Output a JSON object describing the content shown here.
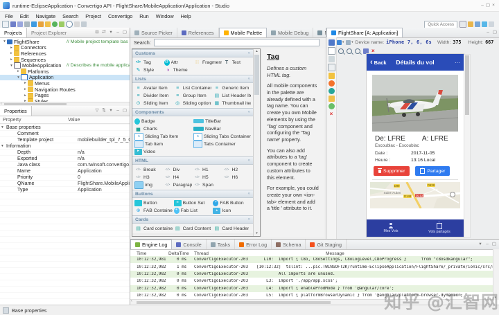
{
  "window": {
    "title": "runtime-EclipseApplication - Convertigo API - FlightShare/MobileApplication/Application - Studio",
    "menus": [
      "File",
      "Edit",
      "Navigate",
      "Search",
      "Project",
      "Convertigo",
      "Run",
      "Window",
      "Help"
    ],
    "toolbar_icons": [
      "new-icon",
      "save-icon",
      "save-all-icon",
      "print-icon",
      "engine-icon",
      "test-platform-icon",
      "pencil-icon",
      "run-icon",
      "debug-icon",
      "search-icon",
      "stop-icon",
      "link-icon"
    ],
    "quick_access": "Quick Access",
    "perspective_icons": [
      "editor-area-icon",
      "java-perspective-icon",
      "debug-perspective-icon",
      "convertigo-perspective-icon",
      "resource-perspective-icon"
    ],
    "window_controls": [
      "minimize-icon",
      "maximize-icon",
      "close-icon"
    ],
    "status_bar": "Base properties"
  },
  "projects_panel": {
    "tabs": [
      {
        "label": "Projects",
        "active": true
      },
      {
        "label": "Project Explorer"
      }
    ],
    "toolbar_icons": [
      "collapse-all-icon",
      "link-editor-icon",
      "view-menu-icon",
      "minimize-icon",
      "maximize-icon"
    ],
    "tree": [
      {
        "label": "FlightShare",
        "icon": "project-icon",
        "depth": 0,
        "arrow": "▾",
        "comment": "// Mobile project template bas"
      },
      {
        "label": "Connectors",
        "icon": "folder-icon",
        "depth": 1,
        "arrow": "▸"
      },
      {
        "label": "References",
        "icon": "folder-icon",
        "depth": 1,
        "arrow": "▸"
      },
      {
        "label": "Sequences",
        "icon": "folder-icon",
        "depth": 1,
        "arrow": "▸"
      },
      {
        "label": "MobileApplication",
        "icon": "mobile-app-icon",
        "depth": 1,
        "arrow": "▾",
        "comment": "// Describes the mobile applica"
      },
      {
        "label": "Platforms",
        "icon": "folder-icon",
        "depth": 2,
        "arrow": "▸"
      },
      {
        "label": "Application",
        "icon": "application-icon",
        "depth": 2,
        "arrow": "▾",
        "selected": true
      },
      {
        "label": "Menus",
        "icon": "folder-icon",
        "depth": 3,
        "arrow": "▸"
      },
      {
        "label": "Navigation Routes",
        "icon": "folder-icon",
        "depth": 3,
        "arrow": "▸"
      },
      {
        "label": "Pages",
        "icon": "folder-icon",
        "depth": 3,
        "arrow": "▸"
      },
      {
        "label": "Styles",
        "icon": "folder-icon",
        "depth": 3,
        "arrow": "▸"
      }
    ]
  },
  "properties_panel": {
    "tab": "Properties",
    "toolbar_icons": [
      "filter-icon",
      "sort-icon",
      "view-menu-icon",
      "minimize-icon",
      "maximize-icon"
    ],
    "columns": [
      "Property",
      "Value"
    ],
    "rows": [
      {
        "label": "Base properties",
        "value": "",
        "group": true,
        "selected": true,
        "arrow": "▾"
      },
      {
        "label": "Comment",
        "value": ""
      },
      {
        "label": "Template project",
        "value": "mobilebuilder_tpl_7_5_0"
      },
      {
        "label": "Information",
        "value": "",
        "group": true,
        "arrow": "▾"
      },
      {
        "label": "Depth",
        "value": "n/a"
      },
      {
        "label": "Exported",
        "value": "n/a"
      },
      {
        "label": "Java class",
        "value": "com.twinsoft.convertigo.beans..."
      },
      {
        "label": "Name",
        "value": "Application"
      },
      {
        "label": "Priority",
        "value": "0"
      },
      {
        "label": "QName",
        "value": "FlightShare.MobileApplication..."
      },
      {
        "label": "Type",
        "value": "Application"
      }
    ]
  },
  "palette_panel": {
    "tabs": [
      {
        "label": "Source Picker",
        "icon": "source-picker-icon"
      },
      {
        "label": "References",
        "icon": "references-icon"
      },
      {
        "label": "Mobile Palette",
        "icon": "mobile-palette-icon",
        "active": true
      },
      {
        "label": "Mobile Debug",
        "icon": "mobile-debug-icon"
      },
      {
        "label": "Mobile Picker",
        "icon": "mobile-picker-icon"
      }
    ],
    "search_label": "Search:",
    "search_value": "",
    "sections": [
      {
        "label": "Customs",
        "cols": 4,
        "items": [
          {
            "label": "Tag",
            "icon": "tag-icon"
          },
          {
            "label": "Attr",
            "icon": "attr-icon"
          },
          {
            "label": "Fragment",
            "icon": "fragment-icon"
          },
          {
            "label": "Text",
            "icon": "text-icon"
          },
          {
            "label": "Style",
            "icon": "style-icon"
          },
          {
            "label": "Theme",
            "icon": "theme-icon"
          }
        ]
      },
      {
        "label": "Lists",
        "cols": 3,
        "items": [
          {
            "label": "Avatar Item",
            "icon": "avatar-item-icon"
          },
          {
            "label": "List Container",
            "icon": "list-container-icon"
          },
          {
            "label": "Generic Item",
            "icon": "generic-item-icon"
          },
          {
            "label": "Divider Item",
            "icon": "divider-item-icon"
          },
          {
            "label": "Group Item",
            "icon": "group-item-icon"
          },
          {
            "label": "List Header Item",
            "icon": "list-header-item-icon"
          },
          {
            "label": "Sliding Item",
            "icon": "sliding-item-icon"
          },
          {
            "label": "Sliding options",
            "icon": "sliding-options-icon"
          },
          {
            "label": "Thumbnail item",
            "icon": "thumbnail-item-icon"
          }
        ]
      },
      {
        "label": "Components",
        "cols": 2,
        "items": [
          {
            "label": "Badge",
            "icon": "badge-icon"
          },
          {
            "label": "TitleBar",
            "icon": "titlebar-icon"
          },
          {
            "label": "Charts",
            "icon": "charts-icon"
          },
          {
            "label": "NavBar",
            "icon": "navbar-icon"
          },
          {
            "label": "Sliding Tab Item",
            "icon": "sliding-tab-item-icon"
          },
          {
            "label": "Sliding Tabs Container",
            "icon": "sliding-tabs-container-icon"
          },
          {
            "label": "Tab Item",
            "icon": "tab-item-icon"
          },
          {
            "label": "Tabs Container",
            "icon": "tabs-container-icon"
          },
          {
            "label": "Video",
            "icon": "video-icon"
          }
        ]
      },
      {
        "label": "HTML",
        "cols": 4,
        "items": [
          {
            "label": "Break",
            "icon": "code-icon"
          },
          {
            "label": "Div",
            "icon": "code-icon"
          },
          {
            "label": "H1",
            "icon": "code-icon"
          },
          {
            "label": "H2",
            "icon": "code-icon"
          },
          {
            "label": "H3",
            "icon": "code-icon"
          },
          {
            "label": "H4",
            "icon": "code-icon"
          },
          {
            "label": "H5",
            "icon": "code-icon"
          },
          {
            "label": "H6",
            "icon": "code-icon"
          },
          {
            "label": "img",
            "icon": "img-icon"
          },
          {
            "label": "Paragraph",
            "icon": "code-icon"
          },
          {
            "label": "Span",
            "icon": "code-icon"
          }
        ]
      },
      {
        "label": "Buttons",
        "cols": 3,
        "items": [
          {
            "label": "Button",
            "icon": "button-icon"
          },
          {
            "label": "Button Set",
            "icon": "button-set-icon"
          },
          {
            "label": "FAB Button",
            "icon": "fab-button-icon"
          },
          {
            "label": "FAB Container",
            "icon": "fab-container-icon"
          },
          {
            "label": "Fab List",
            "icon": "fab-list-icon"
          },
          {
            "label": "Icon",
            "icon": "icon-icon"
          }
        ]
      },
      {
        "label": "Cards",
        "cols": 3,
        "items": [
          {
            "label": "Card container",
            "icon": "card-container-icon"
          },
          {
            "label": "Card Content",
            "icon": "card-content-icon"
          },
          {
            "label": "Card Header",
            "icon": "card-header-icon"
          }
        ]
      }
    ],
    "description": {
      "title": "Tag",
      "subtitle": "Defines a custom HTML tag.",
      "paragraphs": [
        "All mobile components in the palette are already defined with a tag name. You can create you own Mobile elements by using the 'Tag' component and configuring the 'Tag name' property.",
        "You can also add attributes to a 'tag' component to create custom attributes to this element.",
        "For example, you could create your own <ion-tab> element and add a 'title ' attribute to it."
      ]
    }
  },
  "preview_panel": {
    "tab": {
      "label": "FlightShare [A: Application]",
      "icon": "flightshare-tab-icon",
      "active": true
    },
    "device_label": "Device name:",
    "device_name": "iPhone 7, 6, 6s",
    "width_label": "Width:",
    "width_value": "375",
    "height_label": "Height:",
    "height_value": "667",
    "zoom_icons": [
      "zoom-out-icon",
      "zoom-in-icon",
      "zoom-fit-icon",
      "save-icon",
      "close-icon"
    ],
    "side_icons": [
      "grid-icon",
      "page-icon",
      "copy-icon",
      "mail-icon",
      "folder-icon",
      "browser-icon",
      "package-icon",
      "pencil-icon",
      "undo-icon",
      "delete-icon"
    ],
    "phone": {
      "header_color": "#2a4cb8",
      "tabbar_color": "#2c3ea0",
      "delete_color": "#e8433a",
      "share_color": "#2f7bf0",
      "back_label": "Back",
      "title": "Détails du vol",
      "from_label": "De: LFRE",
      "to_label": "A: LFRE",
      "route": "Escoublac - Escoublac",
      "date_label": "Date :",
      "date_value": "2017-11-05",
      "time_label": "Heure :",
      "time_value": "13:16 Local",
      "delete_label": "Supprimer",
      "share_label": "Partager",
      "map": {
        "place": "Saint-Aubin",
        "badges": [
          {
            "text": "D99"
          },
          {
            "text": "D938"
          },
          {
            "text": "D148"
          },
          {
            "text": "D213",
            "red": true
          }
        ]
      },
      "tabs": [
        {
          "label": "Mes Vols",
          "icon": "person-icon"
        },
        {
          "label": "Vols partagés",
          "icon": "share-icon"
        }
      ]
    }
  },
  "log_panel": {
    "tabs": [
      {
        "label": "Engine Log",
        "icon": "engine-log-icon",
        "active": true
      },
      {
        "label": "Console",
        "icon": "console-icon"
      },
      {
        "label": "Tasks",
        "icon": "tasks-icon"
      },
      {
        "label": "Error Log",
        "icon": "error-log-icon"
      },
      {
        "label": "Schema",
        "icon": "schema-icon"
      },
      {
        "label": "Git Staging",
        "icon": "git-staging-icon"
      }
    ],
    "columns": [
      "Time",
      "DeltaTime",
      "Thread",
      "Message"
    ],
    "rows": [
      [
        "10:12:32,981",
        "0 ms",
        "ConvertigoExecutor-203",
        "   L10:  import { C8o, C8oSettings, C8oLogLevel,C8oProgress }      from \"c8osdkangular\";"
      ],
      [
        "10:12:32,982",
        "1 ms",
        "ConvertigoExecutor-203",
        "[10:12:32]  tslint: ...pic.TWINSOFT2K/runtime-EclipseApplication/FlightShare/_private/ionic/src/ma"
      ],
      [
        "10:12:32,982",
        "0 ms",
        "ConvertigoExecutor-203",
        "         All imports are unused."
      ],
      [
        "10:12:32,982",
        "0 ms",
        "ConvertigoExecutor-203",
        "    L3:  import './app/app.scss';"
      ],
      [
        "10:12:32,982",
        "0 ms",
        "ConvertigoExecutor-203",
        "    L4:  import { enableProdMode } from '@angular/core';"
      ],
      [
        "10:12:32,982",
        "0 ms",
        "ConvertigoExecutor-203",
        "    L5:  import { platformBrowserDynamic } from '@angular/platform-browser-dynamic';"
      ]
    ]
  },
  "watermark": "知乎 @汇智网"
}
